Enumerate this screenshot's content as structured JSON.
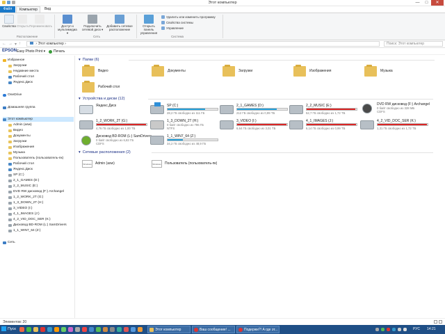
{
  "window": {
    "title": "Этот компьютер",
    "controls": {
      "minimize": "—",
      "maximize": "□",
      "close": "✕"
    }
  },
  "ribbon": {
    "tabs": [
      "Файл",
      "Компьютер",
      "Вид"
    ],
    "buttons": [
      {
        "label": "Свойства"
      },
      {
        "label": "Открыть"
      },
      {
        "label": "Переименовать"
      },
      {
        "label": "Доступ к мультимедиа ▾"
      },
      {
        "label": "Подключить сетевой диск ▾"
      },
      {
        "label": "Добавить сетевое расположение"
      },
      {
        "label": "Открыть панель управления"
      }
    ],
    "small_buttons": [
      "Удалить или изменить программу",
      "Свойства системы",
      "Управление"
    ],
    "groups": [
      "Расположение",
      "Сеть",
      "Система"
    ]
  },
  "address": {
    "path": "Этот компьютер",
    "search_placeholder": "Поиск: Этот компьютер"
  },
  "epson": {
    "logo": "EPSON",
    "product": "Easy Photo Print ▾",
    "print": "Печать"
  },
  "nav": {
    "items": [
      {
        "label": "Избранное"
      },
      {
        "label": "Загрузки"
      },
      {
        "label": "Недавние места"
      },
      {
        "label": "Рабочий стол"
      },
      {
        "label": "Яндекс.Диск"
      },
      {
        "label": "OneDrive"
      },
      {
        "label": "Домашняя группа"
      },
      {
        "label": "Этот компьютер"
      },
      {
        "label": "Admin (asw)"
      },
      {
        "label": "Видео"
      },
      {
        "label": "Документы"
      },
      {
        "label": "Загрузки"
      },
      {
        "label": "Изображения"
      },
      {
        "label": "Музыка"
      },
      {
        "label": "Пользователь (пользователь-пк)"
      },
      {
        "label": "Рабочий стол"
      },
      {
        "label": "Яндекс.Диск"
      },
      {
        "label": "SP (C:)"
      },
      {
        "label": "2_1_GAMES (D:)"
      },
      {
        "label": "2_2_MUSIC (E:)"
      },
      {
        "label": "DVD RW дисковод (F:) Archangel"
      },
      {
        "label": "1_2_WORK_2T (G:)"
      },
      {
        "label": "1_3_DOWN_2T (H:)"
      },
      {
        "label": "3_VIDEO (I:)"
      },
      {
        "label": "4_1_IMAGES (J:)"
      },
      {
        "label": "4_2_VID_DOC_SER (K:)"
      },
      {
        "label": "Дисковод BD-ROM (L:) SamDrivers"
      },
      {
        "label": "1_1_WIN7_64 (Z:)"
      },
      {
        "label": "Сеть"
      }
    ]
  },
  "sections": {
    "folders": "Папки (6)",
    "devices": "Устройства и диски (12)",
    "network": "Сетевые расположения (2)"
  },
  "folders": [
    "Видео",
    "Документы",
    "Загрузки",
    "Изображения",
    "Музыка",
    "Рабочий стол"
  ],
  "drives": [
    {
      "name": "Яндекс.Диск",
      "free": "",
      "used_pct": 0,
      "color": "#26a0da"
    },
    {
      "name": "SP (C:)",
      "free": "28,2 ГБ свободно из 111 ГБ",
      "used_pct": 75,
      "color": "#26a0da"
    },
    {
      "name": "2_1_GAMES (D:)",
      "free": "212 ГБ свободно из 0,99 ТБ",
      "used_pct": 79,
      "color": "#26a0da"
    },
    {
      "name": "2_2_MUSIC (E:)",
      "free": "52,7 ГБ свободно из 1,72 ТБ",
      "used_pct": 97,
      "color": "#da2626"
    },
    {
      "name": "DVD RW дисковод (F:) Archangel",
      "free": "0 байт свободно из 328 МБ",
      "fs": "CDFS",
      "used_pct": 0,
      "color": "#26a0da"
    },
    {
      "name": "1_2_WORK_2T (G:)",
      "free": "4,76 ГБ свободно из 1,00 ТБ",
      "used_pct": 99,
      "color": "#da2626"
    },
    {
      "name": "1_3_DOWN_2T (H:)",
      "free": "0 байт свободно из 786 ГБ",
      "fs": "NTFS",
      "used_pct": 0,
      "color": "#26a0da"
    },
    {
      "name": "3_VIDEO (I:)",
      "free": "6,64 ГБ свободно из 3,01 ТБ",
      "used_pct": 99,
      "color": "#da2626"
    },
    {
      "name": "4_1_IMAGES (J:)",
      "free": "6,14 ГБ свободно из 0,99 ТБ",
      "used_pct": 99,
      "color": "#da2626"
    },
    {
      "name": "4_2_VID_DOC_SER (K:)",
      "free": "1,31 ГБ свободно из 1,72 ТБ",
      "used_pct": 99,
      "color": "#da2626"
    },
    {
      "name": "Дисковод BD-ROM (L:) SamDrivers",
      "free": "0 байт свободно из 6,82 ГБ",
      "fs": "CDFS",
      "used_pct": 0,
      "color": "#26a0da"
    },
    {
      "name": "1_1_WIN7_64 (Z:)",
      "free": "34,2 ГБ свободно из 48,9 ГБ",
      "used_pct": 30,
      "color": "#26a0da"
    }
  ],
  "network": [
    {
      "name": "Admin (asw)",
      "icon_text": "Windows"
    },
    {
      "name": "Пользователь (пользователь-пк)",
      "icon_text": "Windows"
    }
  ],
  "status": {
    "count": "Элементов: 20"
  },
  "taskbar": {
    "start": "Пуск",
    "tasks": [
      "Этот компьютер",
      "Ваш сообщение! ...",
      "Подержи?! А где эт..."
    ],
    "lang": "РУС",
    "clock": "14:21"
  }
}
